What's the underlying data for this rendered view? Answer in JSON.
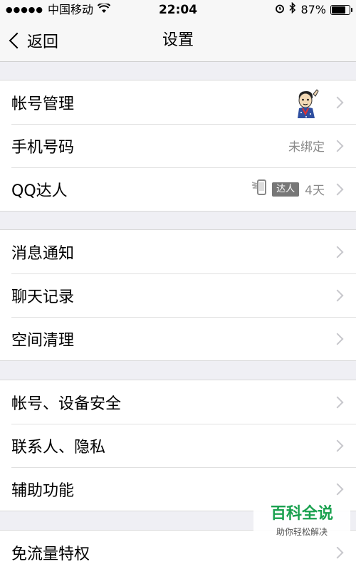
{
  "status": {
    "carrier": "中国移动",
    "time": "22:04",
    "battery": "87%",
    "battery_level": 0.87
  },
  "nav": {
    "back_label": "返回",
    "title": "设置"
  },
  "sections": [
    {
      "items": [
        {
          "label": "帐号管理",
          "detail": ""
        },
        {
          "label": "手机号码",
          "detail": "未绑定"
        },
        {
          "label": "QQ达人",
          "badge": "达人",
          "detail": "4天"
        }
      ]
    },
    {
      "items": [
        {
          "label": "消息通知"
        },
        {
          "label": "聊天记录"
        },
        {
          "label": "空间清理"
        }
      ]
    },
    {
      "items": [
        {
          "label": "帐号、设备安全"
        },
        {
          "label": "联系人、隐私"
        },
        {
          "label": "辅助功能"
        }
      ]
    },
    {
      "items": [
        {
          "label": "免流量特权"
        }
      ]
    }
  ],
  "watermark": {
    "title": "百科全说",
    "subtitle": "助你轻松解决"
  }
}
